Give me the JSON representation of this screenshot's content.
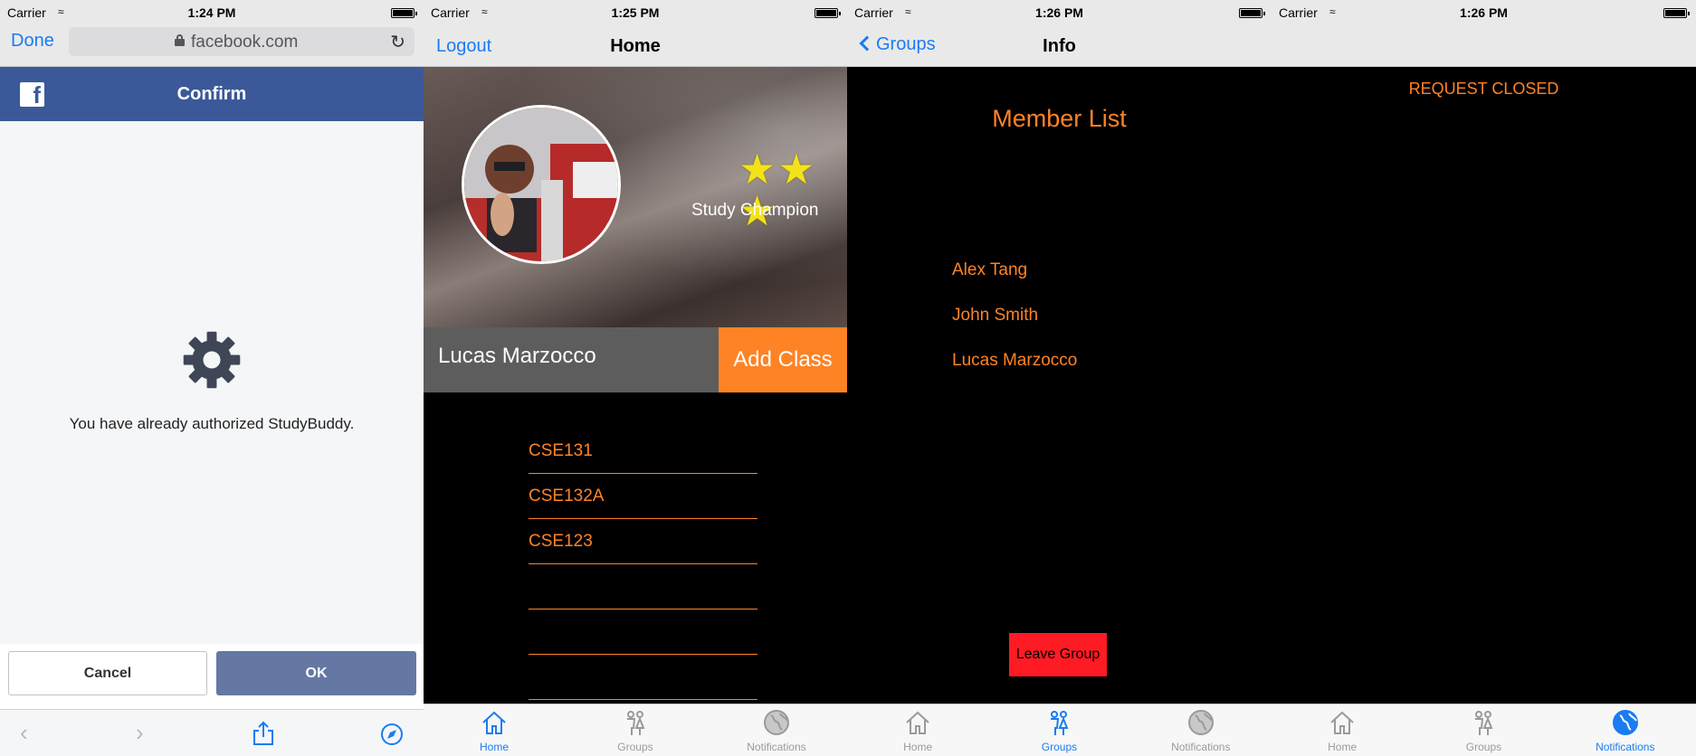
{
  "status_bar": {
    "carrier": "Carrier",
    "times": [
      "1:24 PM",
      "1:25 PM",
      "1:26 PM",
      "1:26 PM"
    ]
  },
  "screen1": {
    "done_label": "Done",
    "url": "facebook.com",
    "header_title": "Confirm",
    "facebook_logo": "f",
    "message": "You have already authorized StudyBuddy.",
    "cancel_label": "Cancel",
    "ok_label": "OK",
    "toolbar_icons": [
      "back-arrow-icon",
      "forward-arrow-icon",
      "share-icon",
      "compass-icon"
    ]
  },
  "screen2": {
    "nav_left": "Logout",
    "nav_title": "Home",
    "rating_stars": 3,
    "rank_label": "Study Champion",
    "user_name": "Lucas Marzocco",
    "add_class_label": "Add Class",
    "classes": [
      "CSE131",
      "CSE132A",
      "CSE123",
      "",
      "",
      ""
    ]
  },
  "screen3": {
    "nav_back": "Groups",
    "nav_title": "Info",
    "member_list_title": "Member List",
    "members": [
      "Alex Tang",
      "John Smith",
      "Lucas Marzocco"
    ],
    "leave_group_label": "Leave Group"
  },
  "screen4": {
    "request_status": "REQUEST CLOSED"
  },
  "tabs": [
    {
      "label": "Home",
      "icon": "home-icon"
    },
    {
      "label": "Groups",
      "icon": "groups-icon"
    },
    {
      "label": "Notifications",
      "icon": "globe-icon"
    }
  ],
  "active_tab_by_screen": [
    "Home",
    "Groups",
    "Notifications"
  ],
  "colors": {
    "ios_blue": "#1a7cf2",
    "facebook_blue": "#3b5998",
    "accent_orange": "#fe8325",
    "leave_red": "#fe1b23",
    "tab_inactive": "#9a9a9a"
  }
}
